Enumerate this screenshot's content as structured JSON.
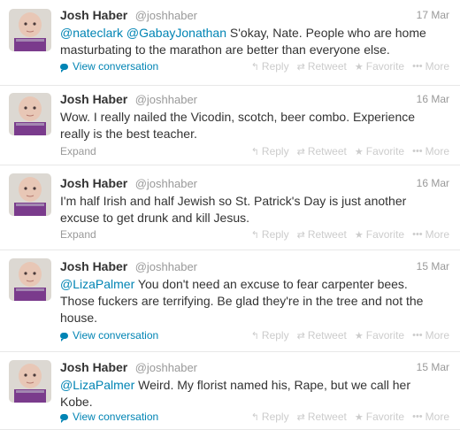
{
  "tweets": [
    {
      "name": "Josh Haber",
      "handle": "@joshhaber",
      "date": "17 Mar",
      "mentions": [
        "@nateclark",
        "@GabayJonathan"
      ],
      "text": "S'okay, Nate. People who are home masturbating to the marathon are better than everyone else.",
      "footer": "View conversation"
    },
    {
      "name": "Josh Haber",
      "handle": "@joshhaber",
      "date": "16 Mar",
      "text": "Wow. I really nailed the Vicodin, scotch, beer combo. Experience really is the best teacher.",
      "footer": "Expand"
    },
    {
      "name": "Josh Haber",
      "handle": "@joshhaber",
      "date": "16 Mar",
      "text": "I'm half Irish and half Jewish so St. Patrick's Day is just another excuse to get drunk and kill Jesus.",
      "footer": "Expand"
    },
    {
      "name": "Josh Haber",
      "handle": "@joshhaber",
      "date": "15 Mar",
      "mentions": [
        "@LizaPalmer"
      ],
      "text": "You don't need an excuse to fear carpenter bees. Those fuckers are terrifying. Be glad they're in the tree and not the house.",
      "footer": "View conversation"
    },
    {
      "name": "Josh Haber",
      "handle": "@joshhaber",
      "date": "15 Mar",
      "mentions": [
        "@LizaPalmer"
      ],
      "text": "Weird. My florist named his, Rape, but we call her Kobe.",
      "footer": "View conversation"
    }
  ],
  "actions": {
    "reply": "Reply",
    "retweet": "Retweet",
    "favorite": "Favorite",
    "more": "More",
    "reply_icon": "reply-arrow-icon",
    "retweet_icon": "retweet-arrows-icon",
    "favorite_icon": "star-icon",
    "more_icon": "dots-icon"
  },
  "colors": {
    "link": "#0084b4",
    "muted": "#999999",
    "action": "#cccccc",
    "text": "#333333"
  }
}
